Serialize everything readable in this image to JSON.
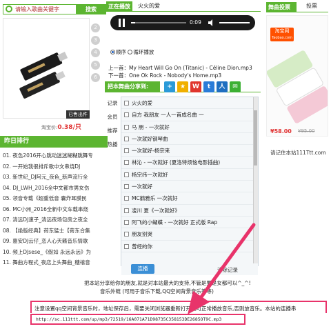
{
  "search": {
    "placeholder": "请输入歌曲关键字",
    "button": "搜索"
  },
  "carousel": {
    "numbers": [
      "2",
      "3",
      "4",
      "5",
      "6"
    ]
  },
  "promo": {
    "sold_out": "已售出件",
    "price_label": "淘宝价:",
    "price": "0.38/只"
  },
  "ranking": {
    "title": "昨日排行",
    "items": [
      "01. 夜色2016开心跳动迷迷糊糊跳舞专",
      "02. 一开始我很排斥歌中文串烧DJ",
      "03. 新世纪_DJ阿元_夜色_新声流行全",
      "04. DJ_LWH_2016全中文都市男女伤",
      "05. 领音专载《超重低音 囊炸耳膜民",
      "06. MC小洲_2016全新中文车载串烧",
      "07. 清远DJ速子_清远夜场包房之夜全",
      "08. 【绝版经典】荷东猛士【荷东合集",
      "09. 惠安DJ云仔_恋人心天籁音乐情歌",
      "10. 频上DJsese_《假如 永远永远》为",
      "11. 舞曲方程式_夜店上头舞曲_穗禧音"
    ]
  },
  "now_playing": {
    "label": "正在播放",
    "title": "火火的爱",
    "time": "0:09"
  },
  "mode": {
    "sequential": "顺序",
    "loop": "循环播放"
  },
  "prev": {
    "label": "上一首：",
    "song": "My Heart Will Go On (Titanic) - Céline Dion.mp3"
  },
  "next": {
    "label": "下一首：",
    "song": "One Ok Rock - Nobody's Home.mp3"
  },
  "share": {
    "label": "把本舞曲分享到:",
    "icons": [
      {
        "name": "plus-share-icon",
        "glyph": "+",
        "color": "#2a9ad8"
      },
      {
        "name": "qzone-icon",
        "glyph": "★",
        "color": "#f0b000"
      },
      {
        "name": "weibo-icon",
        "glyph": "W",
        "color": "#e0352d"
      },
      {
        "name": "tencent-weibo-icon",
        "glyph": "t",
        "color": "#2a7cd8"
      },
      {
        "name": "renren-icon",
        "glyph": "人",
        "color": "#1f6fc0"
      },
      {
        "name": "wechat-icon",
        "glyph": "✉",
        "color": "#3cb034"
      }
    ]
  },
  "side_tabs": [
    "记录",
    "会员",
    "推荐",
    "热播"
  ],
  "playlist": {
    "items": [
      "火火的爱",
      "自方 我朋友 一人一首成名曲 一",
      "马 朋 - 一次就好",
      "一次就好钢琴曲",
      "一次就好-杨宗来",
      "林沁 - 一次就好 (夏洛特烦恼电影插曲)",
      "杨宗纬一次就好",
      "一次就好",
      "MC鹤雅乐 一次就好",
      "凌川 夏《一次就好》",
      "阿飞的小蝴蝶 - 一次就好 正式版 Rap",
      "朋友别哭",
      "曾经的你"
    ],
    "control_button": "连播",
    "clear": "清除记录"
  },
  "vote": {
    "label": "舞曲投票",
    "button": "投票"
  },
  "ad": {
    "brand_top": "淘宝网",
    "brand_bottom": "Taobao.com",
    "price": "¥58.00",
    "old_price": "¥95.00"
  },
  "site_note": "请记住本站111Ttt.com",
  "footer": {
    "line1": "把本站分享给你的朋友,就是对本站最大的支持,不管是男是女都可以^_^!",
    "line2": "音乐外链 (可用于音乐下载,QQ空间背景音乐等等)",
    "line3": "注意设置qq空间背景音乐时，地址保存后，需要关闭浏览器重新打开就可正常播放音乐,否则放音乐。本站的连播串",
    "url": "http://sc.111ttt.com/up/mp3/72519/16A071A71D98735C358153DE2685OT9C.mp3"
  },
  "colors": {
    "accent_green": "#5cb531",
    "arrow_pink": "#e8336a",
    "price_red": "#e03030"
  }
}
